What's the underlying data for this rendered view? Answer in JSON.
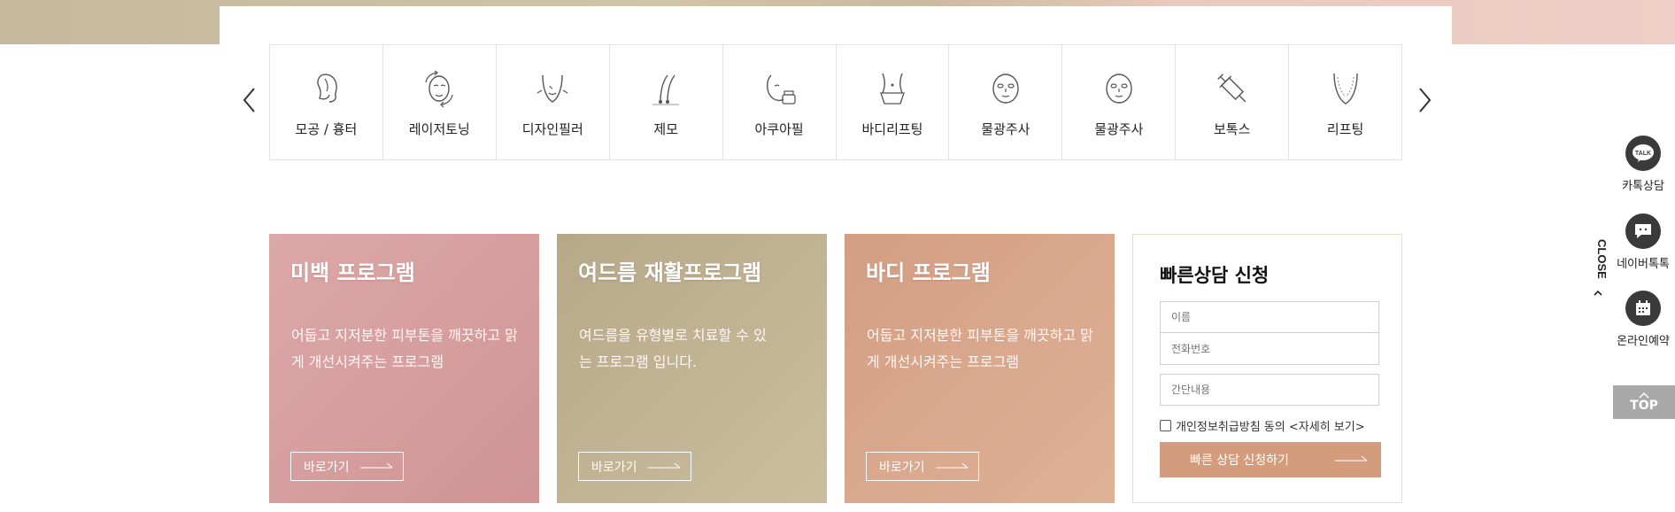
{
  "categories": [
    {
      "label": "모공 / 흉터",
      "icon": "face-profile-icon"
    },
    {
      "label": "레이저토닝",
      "icon": "face-rotate-icon"
    },
    {
      "label": "디자인필러",
      "icon": "chin-contour-icon"
    },
    {
      "label": "제모",
      "icon": "hair-follicle-icon"
    },
    {
      "label": "아쿠아필",
      "icon": "face-cream-icon"
    },
    {
      "label": "바디리프팅",
      "icon": "waist-icon"
    },
    {
      "label": "물광주사",
      "icon": "face-mask-icon"
    },
    {
      "label": "물광주사",
      "icon": "face-mask-icon"
    },
    {
      "label": "보톡스",
      "icon": "syringe-icon"
    },
    {
      "label": "리프팅",
      "icon": "face-lifting-icon"
    }
  ],
  "programs": [
    {
      "title": "미백 프로그램",
      "desc": "어둡고 지저분한 피부톤을 깨끗하고 맑게 개선시켜주는 프로그램",
      "button": "바로가기"
    },
    {
      "title": "여드름 재활프로그램",
      "desc": "여드름을 유형별로 치료할 수 있는 프로그램 입니다.",
      "button": "바로가기"
    },
    {
      "title": "바디 프로그램",
      "desc": "어둡고 지저분한 피부톤을 깨끗하고 맑게 개선시켜주는 프로그램",
      "button": "바로가기"
    }
  ],
  "quick_form": {
    "title": "빠른상담 신청",
    "name_placeholder": "이름",
    "phone_placeholder": "전화번호",
    "message_placeholder": "간단내용",
    "agree_label": "개인정보취급방침 동의 <자세히 보기>",
    "submit_label": "빠른 상담 신청하기"
  },
  "sidebar": {
    "kakao_label": "카톡상담",
    "naver_label": "네이버톡톡",
    "reserve_label": "온라인예약",
    "close_label": "CLOSE",
    "top_label": "TOP",
    "talk_badge": "TALK"
  },
  "colors": {
    "program1": "#d9a0a0",
    "program2": "#c0b293",
    "program3": "#d9a78c",
    "submit": "#d29c7d",
    "side_icon": "#3a3a3a"
  }
}
